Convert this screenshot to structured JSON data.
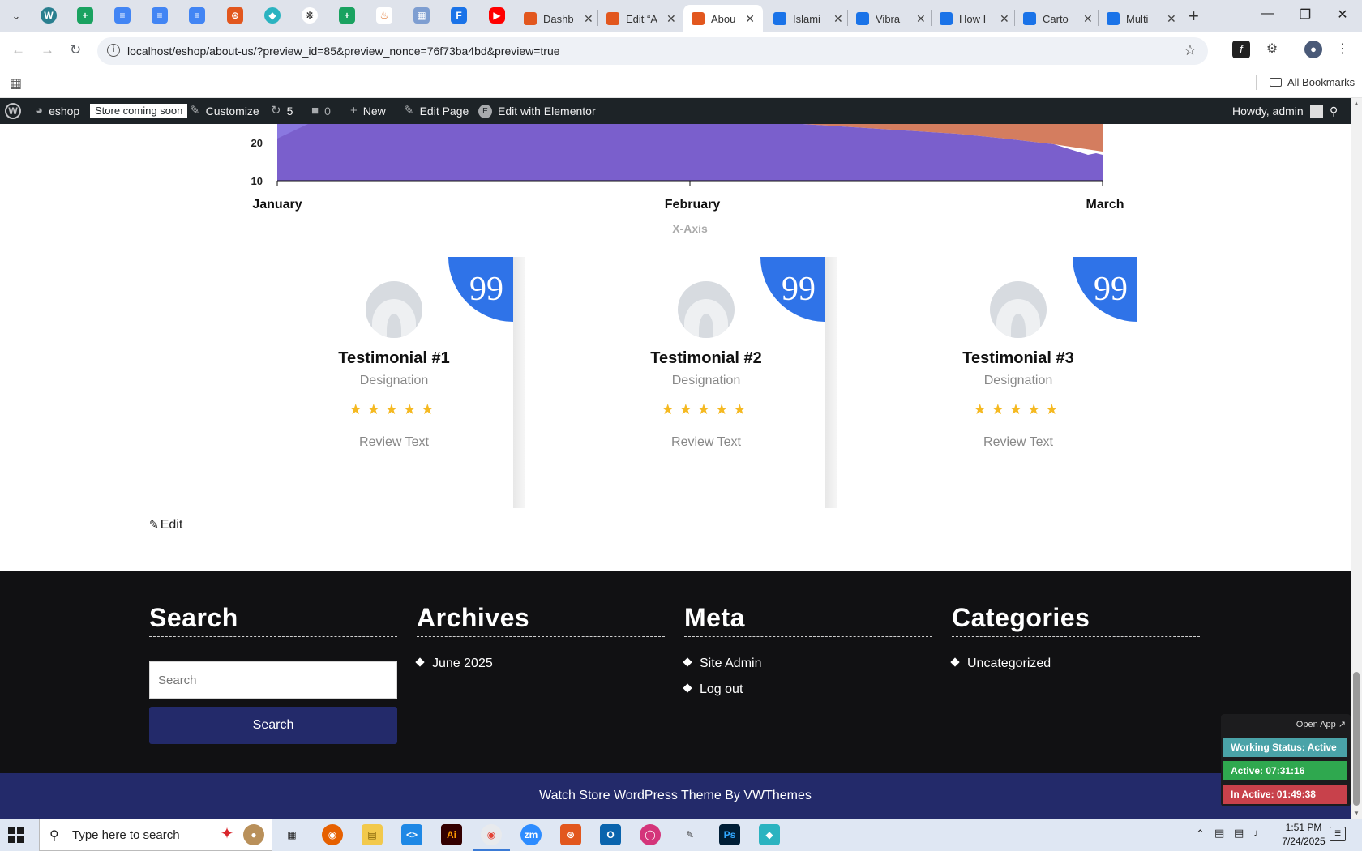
{
  "browser": {
    "tabs": [
      {
        "label": "Dashb",
        "favicon_color": "#e2571e"
      },
      {
        "label": "Edit “A",
        "favicon_color": "#e2571e"
      },
      {
        "label": "About",
        "favicon_color": "#e2571e",
        "active": true
      },
      {
        "label": "Islami",
        "favicon_color": "#1a73e8"
      },
      {
        "label": "Vibra",
        "favicon_color": "#1a73e8"
      },
      {
        "label": "How I",
        "favicon_color": "#1a73e8"
      },
      {
        "label": "Carto",
        "favicon_color": "#1a73e8"
      },
      {
        "label": "Multi",
        "favicon_color": "#1a73e8"
      }
    ],
    "url": "localhost/eshop/about-us/?preview_id=85&preview_nonce=76f73ba4bd&preview=true",
    "bookmarks_label": "All Bookmarks"
  },
  "adminbar": {
    "site": "eshop",
    "badge": "Store coming soon",
    "customize": "Customize",
    "updates": "5",
    "comments": "0",
    "new": "New",
    "edit_page": "Edit Page",
    "elementor": "Edit with Elementor",
    "howdy": "Howdy, admin"
  },
  "chart_data": {
    "type": "area",
    "categories": [
      "January",
      "February",
      "March"
    ],
    "y_ticks": [
      "20",
      "10"
    ],
    "xlabel": "X-Axis",
    "colors": {
      "purple": "#7a5fcc",
      "orange": "#d47d5f"
    }
  },
  "testimonials": [
    {
      "name": "Testimonial #1",
      "designation": "Designation",
      "stars": "★★★★★",
      "review": "Review Text",
      "quote": "99"
    },
    {
      "name": "Testimonial #2",
      "designation": "Designation",
      "stars": "★★★★★",
      "review": "Review Text",
      "quote": "99"
    },
    {
      "name": "Testimonial #3",
      "designation": "Designation",
      "stars": "★★★★★",
      "review": "Review Text",
      "quote": "99"
    }
  ],
  "edit_link": "Edit",
  "footer": {
    "search_title": "Search",
    "search_placeholder": "Search",
    "search_button": "Search",
    "archives_title": "Archives",
    "archives": [
      "June 2025"
    ],
    "meta_title": "Meta",
    "meta": [
      "Site Admin",
      "Log out"
    ],
    "categories_title": "Categories",
    "categories": [
      "Uncategorized"
    ],
    "copyright": "Watch Store WordPress Theme By VWThemes"
  },
  "tracker": {
    "open_app": "Open App ↗",
    "status": "Working Status: Active",
    "active": "Active: 07:31:16",
    "inactive": "In Active: 01:49:38"
  },
  "taskbar": {
    "search_placeholder": "Type here to search",
    "time": "1:51 PM",
    "date": "7/24/2025"
  }
}
